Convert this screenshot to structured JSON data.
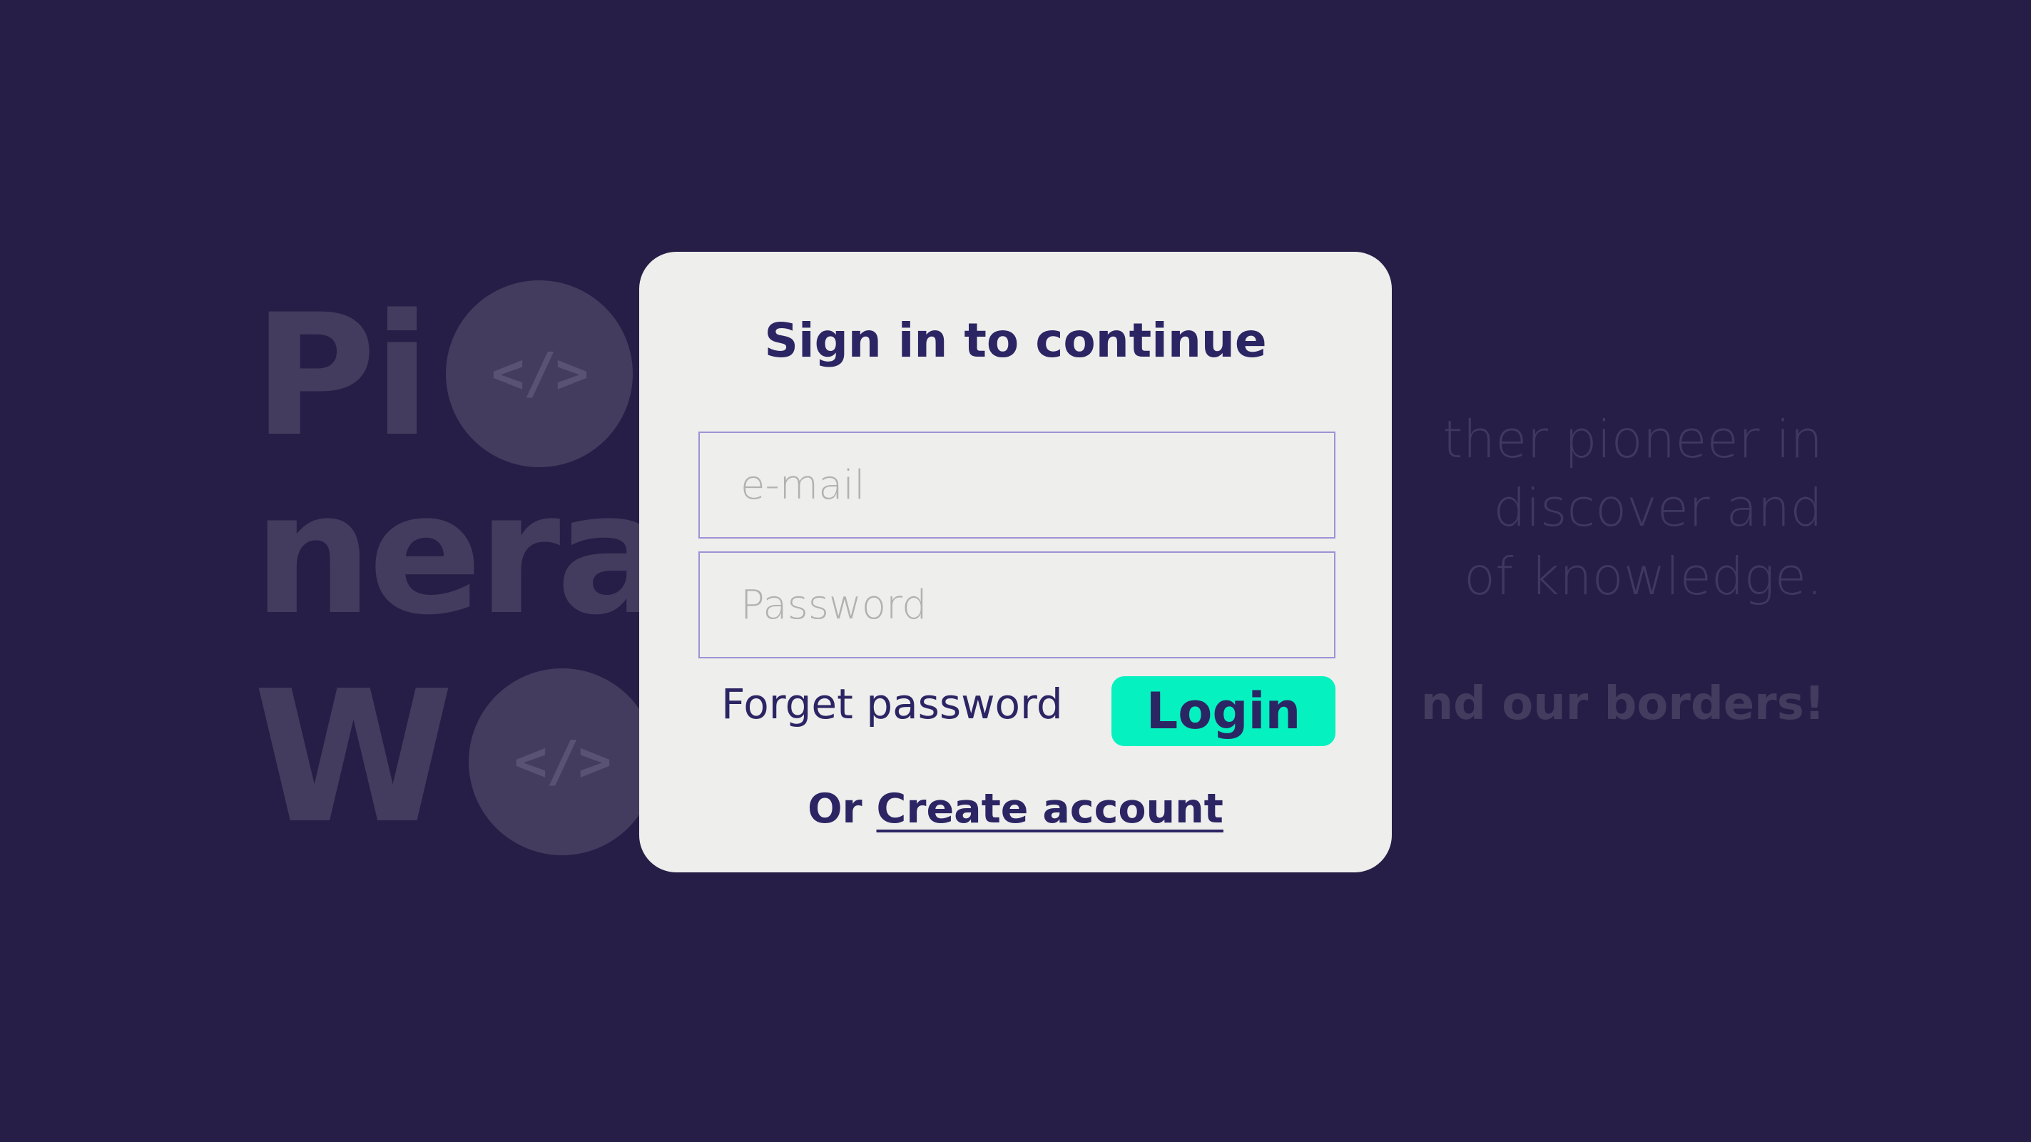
{
  "background": {
    "brand_lines": [
      "Pi",
      "nera",
      "W"
    ],
    "code_badge_glyph": "</>",
    "paragraph_lines": [
      "ther pioneer in",
      "discover and",
      "of knowledge."
    ],
    "tagline": "nd our borders!"
  },
  "login": {
    "title": "Sign in to continue",
    "email_placeholder": "e-mail",
    "password_placeholder": "Password",
    "forgot_label": "Forget password",
    "login_label": "Login",
    "or_label": "Or",
    "create_account_label": "Create account"
  },
  "colors": {
    "page_background": "#271e47",
    "card_background": "#eeeeec",
    "primary_text": "#2c2564",
    "accent_button": "#05f1c0",
    "field_border": "#9f91d6"
  }
}
